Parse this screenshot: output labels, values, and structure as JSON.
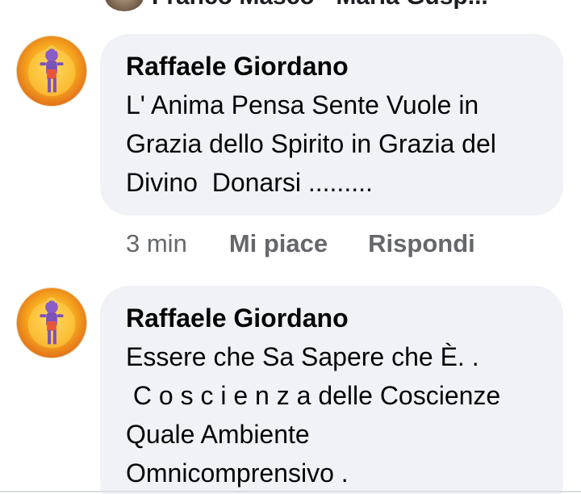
{
  "previous": {
    "names_cut": "Franco Masco · Maria Gusp..."
  },
  "comments": [
    {
      "author": "Raffaele Giordano",
      "text": "L' Anima Pensa Sente Vuole in\nGrazia dello Spirito in Grazia del\nDivino  Donarsi .........",
      "time": "3 min",
      "like_label": "Mi piace",
      "reply_label": "Rispondi"
    },
    {
      "author": "Raffaele Giordano",
      "text": "Essere che Sa Sapere che È. .\n C o s c i e n z a delle Coscienze\nQuale Ambiente\nOmnicomprensivo ."
    }
  ],
  "colors": {
    "bubble": "#f0f2f5",
    "meta": "#65676b",
    "text": "#050505"
  }
}
